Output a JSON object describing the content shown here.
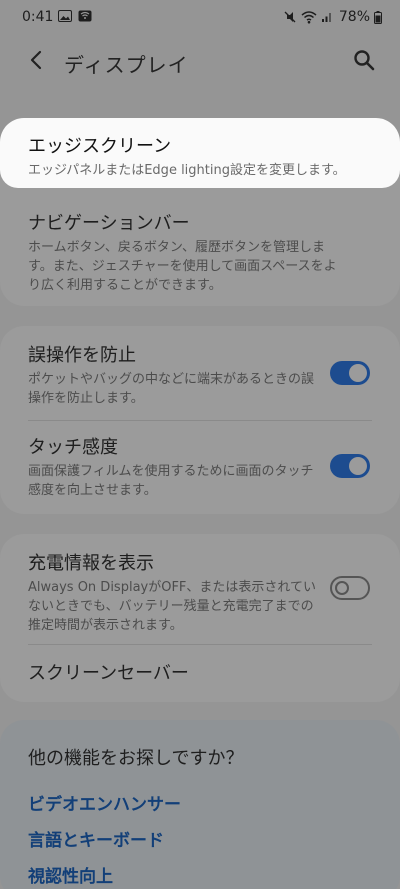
{
  "status_bar": {
    "time": "0:41",
    "battery": "78%",
    "left_icons": [
      "image-icon",
      "notification-icon"
    ],
    "right_icons": [
      "mute-icon",
      "wifi-icon",
      "signal-icon",
      "battery-icon"
    ]
  },
  "appbar": {
    "title": "ディスプレイ",
    "back_icon": "back-arrow-icon",
    "search_icon": "search-icon"
  },
  "sections": {
    "edge_screen": {
      "title": "エッジスクリーン",
      "desc": "エッジパネルまたはEdge lighting設定を変更します。"
    },
    "navigation_bar": {
      "title": "ナビゲーションバー",
      "desc": "ホームボタン、戻るボタン、履歴ボタンを管理します。また、ジェスチャーを使用して画面スペースをより広く利用することができます。"
    },
    "accidental_touch": {
      "title": "誤操作を防止",
      "desc": "ポケットやバッグの中などに端末があるときの誤操作を防止します。",
      "enabled": true
    },
    "touch_sensitivity": {
      "title": "タッチ感度",
      "desc": "画面保護フィルムを使用するために画面のタッチ感度を向上させます。",
      "enabled": true
    },
    "charging_info": {
      "title": "充電情報を表示",
      "desc": "Always On DisplayがOFF、または表示されていないときでも、バッテリー残量と充電完了までの推定時間が表示されます。",
      "enabled": false
    },
    "screensaver": {
      "title": "スクリーンセーバー"
    }
  },
  "more": {
    "title": "他の機能をお探しですか？",
    "links": [
      "ビデオエンハンサー",
      "言語とキーボード",
      "視認性向上"
    ]
  },
  "colors": {
    "toggle_on": "#1d4c8f",
    "link": "#123f78",
    "dim_overlay": "#959595",
    "highlight_card": "#fafafa"
  }
}
